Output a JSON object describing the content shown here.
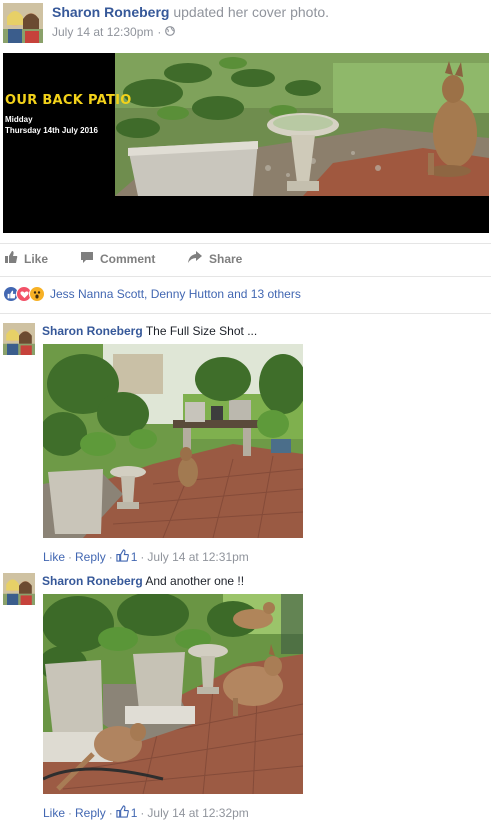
{
  "post": {
    "author": "Sharon Roneberg",
    "action_text": "updated her cover photo.",
    "timestamp": "July 14 at 12:30pm",
    "privacy_icon": "globe-icon",
    "cover": {
      "title": "OUR BACK PATIO",
      "line1": "Midday",
      "line2": "Thursday 14th July 2016"
    }
  },
  "actions": {
    "like": "Like",
    "comment": "Comment",
    "share": "Share"
  },
  "reactions": {
    "types": [
      "like",
      "love",
      "wow"
    ],
    "summary": "Jess Nanna Scott, Denny Hutton and 13 others"
  },
  "comments": [
    {
      "author": "Sharon Roneberg",
      "text": "The Full Size Shot ...",
      "like_label": "Like",
      "reply_label": "Reply",
      "likes": "1",
      "timestamp": "July 14 at 12:31pm"
    },
    {
      "author": "Sharon Roneberg",
      "text": "And another one !!",
      "like_label": "Like",
      "reply_label": "Reply",
      "likes": "1",
      "timestamp": "July 14 at 12:32pm"
    }
  ],
  "colors": {
    "link_blue": "#365899",
    "meta_gray": "#90949c",
    "cover_title_yellow": "#f3d21a",
    "like_blue": "#4267b2",
    "love_red": "#f25268",
    "wow_yellow": "#f7b125"
  }
}
